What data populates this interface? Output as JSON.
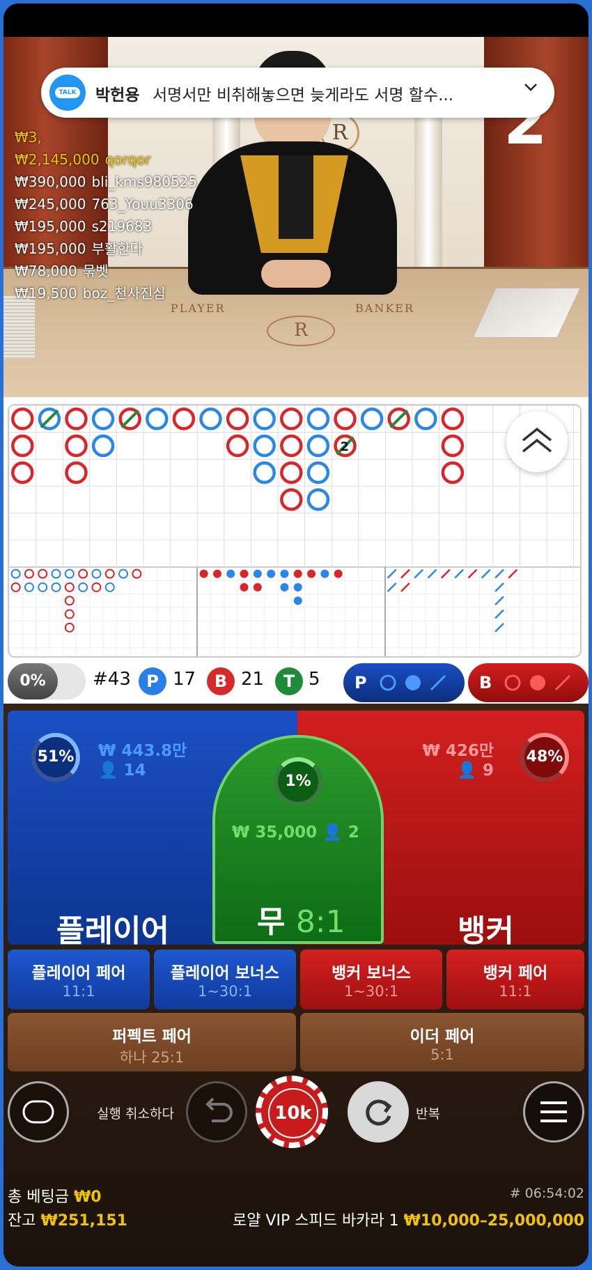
{
  "video": {
    "round_number": "2",
    "felt_player": "PLAYER",
    "felt_banker": "BANKER",
    "emblem_letter": "R",
    "leaderboard": [
      {
        "amount": "₩3,",
        "name": ""
      },
      {
        "amount": "₩2,145,000",
        "name": "qorqor"
      },
      {
        "amount": "₩390,000",
        "name": "bli_kms980525"
      },
      {
        "amount": "₩245,000",
        "name": "763_Youu3306"
      },
      {
        "amount": "₩195,000",
        "name": "s219683"
      },
      {
        "amount": "₩195,000",
        "name": "부활한다"
      },
      {
        "amount": "₩78,000",
        "name": "묶벳"
      },
      {
        "amount": "₩19,500",
        "name": "boz_천사진심"
      }
    ]
  },
  "notification": {
    "app_icon": "talk-icon",
    "app_icon_text": "TALK",
    "sender": "박헌용",
    "message": "서명서만 비취해놓으면  늦게라도 서명 할수...",
    "chevron": "chevron-down-icon"
  },
  "scoreboard": {
    "bead_road": [
      [
        "B",
        "B",
        "B"
      ],
      [
        "P-T"
      ],
      [
        "B",
        "B-x",
        "B"
      ],
      [
        "P",
        "P"
      ],
      [
        "B-T"
      ],
      [
        "P"
      ],
      [
        "B-x"
      ],
      [
        "P"
      ],
      [
        "B",
        "B"
      ],
      [
        "P",
        "P-x",
        "P"
      ],
      [
        "B",
        "B",
        "B",
        "B"
      ],
      [
        "P",
        "P",
        "P",
        "P"
      ],
      [
        "B",
        "B-T2"
      ],
      [
        "P"
      ],
      [
        "B-T"
      ],
      [
        "P"
      ],
      [
        "B",
        "B",
        "B"
      ]
    ],
    "round_count": "#43",
    "player_letter": "P",
    "player_count": "17",
    "banker_letter": "B",
    "banker_count": "21",
    "tie_letter": "T",
    "tie_count": "5",
    "percent_toggle": "0%",
    "predict_player": "P",
    "predict_banker": "B"
  },
  "betting": {
    "player": {
      "percent": "51%",
      "amount": "₩ 443.8만",
      "players": "14",
      "label": "플레이어"
    },
    "banker": {
      "percent": "48%",
      "amount": "₩ 426만",
      "players": "9",
      "label": "뱅커"
    },
    "tie": {
      "percent": "1%",
      "amount": "₩ 35,000",
      "players": "2",
      "label": "무",
      "odds": "8:1"
    },
    "side_bets": [
      {
        "label": "플레이어 페어",
        "odds": "11:1"
      },
      {
        "label": "플레이어 보너스",
        "odds": "1~30:1"
      },
      {
        "label": "뱅커 보너스",
        "odds": "1~30:1"
      },
      {
        "label": "뱅커 페어",
        "odds": "11:1"
      }
    ],
    "perfect_pair": {
      "label": "퍼펙트 페어",
      "odds": "하나 25:1"
    },
    "either_pair": {
      "label": "이더 페어",
      "odds": "5:1"
    }
  },
  "controls": {
    "undo_label": "실행 취소하다",
    "chip_value": "10k",
    "repeat_label": "반복"
  },
  "footer": {
    "total_bet_label": "총 베팅금",
    "total_bet_value": "₩0",
    "balance_label": "잔고",
    "balance_value": "₩251,151",
    "game_id": "# 06:54:02",
    "table_name": "로얄 VIP 스피드 바카라 1",
    "limits": "₩10,000–25,000,000"
  },
  "colors": {
    "player_blue": "#1b4fc3",
    "banker_red": "#d21f1f",
    "tie_green": "#1f8a25",
    "gold": "#f0c400"
  }
}
